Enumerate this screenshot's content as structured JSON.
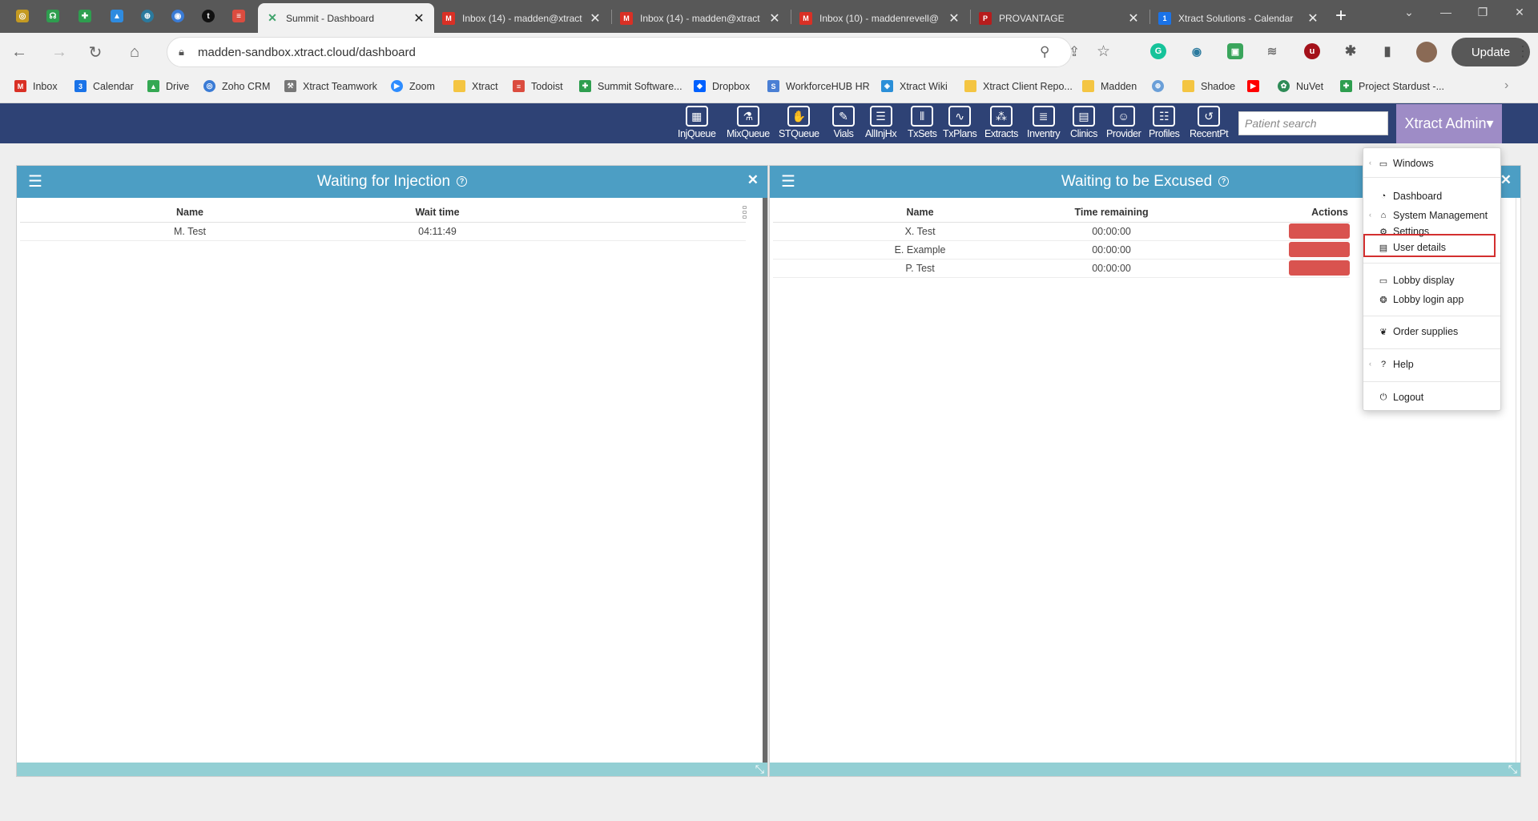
{
  "browser": {
    "tabs": [
      {
        "title": "Summit - Dashboard",
        "active": true,
        "favicon_color": "#3fa36b",
        "favicon_glyph": "✕"
      },
      {
        "title": "Inbox (14) - madden@xtract",
        "active": false,
        "favicon_color": "#d93025",
        "favicon_glyph": "M"
      },
      {
        "title": "Inbox (14) - madden@xtract",
        "active": false,
        "favicon_color": "#d93025",
        "favicon_glyph": "M"
      },
      {
        "title": "Inbox (10) - maddenrevell@",
        "active": false,
        "favicon_color": "#d93025",
        "favicon_glyph": "M"
      },
      {
        "title": "PROVANTAGE",
        "active": false,
        "favicon_color": "#b71c1c",
        "favicon_glyph": "P"
      },
      {
        "title": "Xtract Solutions - Calendar",
        "active": false,
        "favicon_color": "#1a73e8",
        "favicon_glyph": "1"
      }
    ],
    "new_tab_label": "+",
    "url": "madden-sandbox.xtract.cloud/dashboard",
    "update_label": "Update",
    "bookmarks": [
      {
        "label": "Inbox",
        "color": "#d93025",
        "icon": "gmail-icon"
      },
      {
        "label": "Calendar",
        "color": "#1a73e8",
        "icon": "calendar-icon"
      },
      {
        "label": "Drive",
        "color": "#34a853",
        "icon": "drive-icon"
      },
      {
        "label": "Zoho CRM",
        "color": "#3a7bd5",
        "icon": "zoho-icon"
      },
      {
        "label": "Xtract Teamwork",
        "color": "#777777",
        "icon": "teamwork-icon"
      },
      {
        "label": "Zoom",
        "color": "#2d8cff",
        "icon": "zoom-icon"
      },
      {
        "label": "Xtract",
        "color": "#f4c542",
        "icon": "folder-icon"
      },
      {
        "label": "Todoist",
        "color": "#db4c3f",
        "icon": "todoist-icon"
      },
      {
        "label": "Summit Software...",
        "color": "#2e9e4f",
        "icon": "summit-icon"
      },
      {
        "label": "Dropbox",
        "color": "#0061ff",
        "icon": "dropbox-icon"
      },
      {
        "label": "WorkforceHUB HR",
        "color": "#4a7fd4",
        "icon": "workforcehub-icon"
      },
      {
        "label": "Xtract Wiki",
        "color": "#2b8fd8",
        "icon": "wiki-icon"
      },
      {
        "label": "Xtract Client Repo...",
        "color": "#f4c542",
        "icon": "folder-icon"
      },
      {
        "label": "Madden",
        "color": "#f4c542",
        "icon": "folder-icon"
      },
      {
        "label": "",
        "color": "#6a9fd8",
        "icon": "globe-icon"
      },
      {
        "label": "Shadoe",
        "color": "#f4c542",
        "icon": "folder-icon"
      },
      {
        "label": "",
        "color": "#ff0000",
        "icon": "youtube-icon"
      },
      {
        "label": "NuVet",
        "color": "#2e8b57",
        "icon": "paw-icon"
      },
      {
        "label": "Project Stardust -...",
        "color": "#2e9e4f",
        "icon": "summit-icon"
      }
    ]
  },
  "app": {
    "nav_items": [
      {
        "label": "InjQueue",
        "glyph": "▦"
      },
      {
        "label": "MixQueue",
        "glyph": "⚗"
      },
      {
        "label": "STQueue",
        "glyph": "✋"
      },
      {
        "label": "Vials",
        "glyph": "✎"
      },
      {
        "label": "AllInjHx",
        "glyph": "☰"
      },
      {
        "label": "TxSets",
        "glyph": "⫴"
      },
      {
        "label": "TxPlans",
        "glyph": "∿"
      },
      {
        "label": "Extracts",
        "glyph": "⁂"
      },
      {
        "label": "Inventry",
        "glyph": "≣"
      },
      {
        "label": "Clinics",
        "glyph": "▤"
      },
      {
        "label": "Provider",
        "glyph": "☺"
      },
      {
        "label": "Profiles",
        "glyph": "☷"
      },
      {
        "label": "RecentPt",
        "glyph": "↺"
      }
    ],
    "patient_search_placeholder": "Patient search",
    "admin_menu_label": "Xtract Admin"
  },
  "panels": {
    "injection": {
      "title": "Waiting for Injection",
      "columns": [
        "Name",
        "Wait time"
      ],
      "rows": [
        {
          "name": "M. Test",
          "wait": "04:11:49"
        }
      ]
    },
    "excused": {
      "title": "Waiting to be Excused",
      "columns": [
        "Name",
        "Time remaining",
        "Actions"
      ],
      "rows": [
        {
          "name": "X. Test",
          "remaining": "00:00:00"
        },
        {
          "name": "E. Example",
          "remaining": "00:00:00"
        },
        {
          "name": "P. Test",
          "remaining": "00:00:00"
        }
      ]
    }
  },
  "dropdown": {
    "items": {
      "windows": "Windows",
      "dashboard": "Dashboard",
      "system_management": "System Management",
      "settings": "Settings",
      "user_details": "User details",
      "lobby_display": "Lobby display",
      "lobby_login_app": "Lobby login app",
      "order_supplies": "Order supplies",
      "help": "Help",
      "logout": "Logout"
    },
    "highlighted_item": "User details"
  },
  "colors": {
    "app_header": "#2e4275",
    "admin_button": "#9e8cc6",
    "panel_header": "#4c9ec4",
    "panel_footer": "#93cfd4",
    "action_button": "#d9534f",
    "highlight_box": "#d32f2f"
  }
}
